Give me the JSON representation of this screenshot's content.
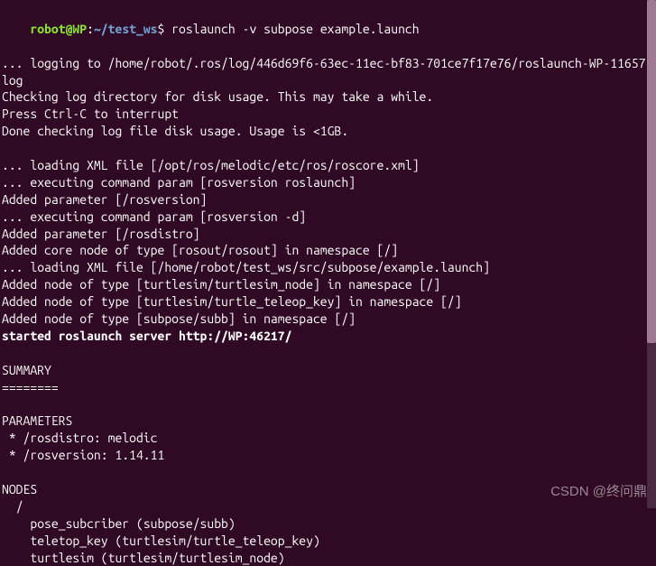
{
  "prompt": {
    "user": "robot@WP",
    "colon": ":",
    "path": "~/test_ws",
    "dollar": "$ ",
    "command": "roslaunch -v subpose example.launch"
  },
  "lines": {
    "l1": "... logging to /home/robot/.ros/log/446d69f6-63ec-11ec-bf83-701ce7f17e76/roslaunch-WP-11657.log",
    "l2": "Checking log directory for disk usage. This may take a while.",
    "l3": "Press Ctrl-C to interrupt",
    "l4": "Done checking log file disk usage. Usage is <1GB.",
    "l5": "",
    "l6": "... loading XML file [/opt/ros/melodic/etc/ros/roscore.xml]",
    "l7": "... executing command param [rosversion roslaunch]",
    "l8": "Added parameter [/rosversion]",
    "l9": "... executing command param [rosversion -d]",
    "l10": "Added parameter [/rosdistro]",
    "l11": "Added core node of type [rosout/rosout] in namespace [/]",
    "l12": "... loading XML file [/home/robot/test_ws/src/subpose/example.launch]",
    "l13": "Added node of type [turtlesim/turtlesim_node] in namespace [/]",
    "l14": "Added node of type [turtlesim/turtle_teleop_key] in namespace [/]",
    "l15": "Added node of type [subpose/subb] in namespace [/]",
    "l16": "started roslaunch server http://WP:46217/",
    "l17": "",
    "l18": "SUMMARY",
    "l19": "========",
    "l20": "",
    "l21": "PARAMETERS",
    "l22": " * /rosdistro: melodic",
    "l23": " * /rosversion: 1.14.11",
    "l24": "",
    "l25": "NODES",
    "l26": "  /",
    "l27": "    pose_subcriber (subpose/subb)",
    "l28": "    teletop_key (turtlesim/turtle_teleop_key)",
    "l29": "    turtlesim (turtlesim/turtlesim_node)"
  },
  "watermark": "CSDN @终问鼎"
}
